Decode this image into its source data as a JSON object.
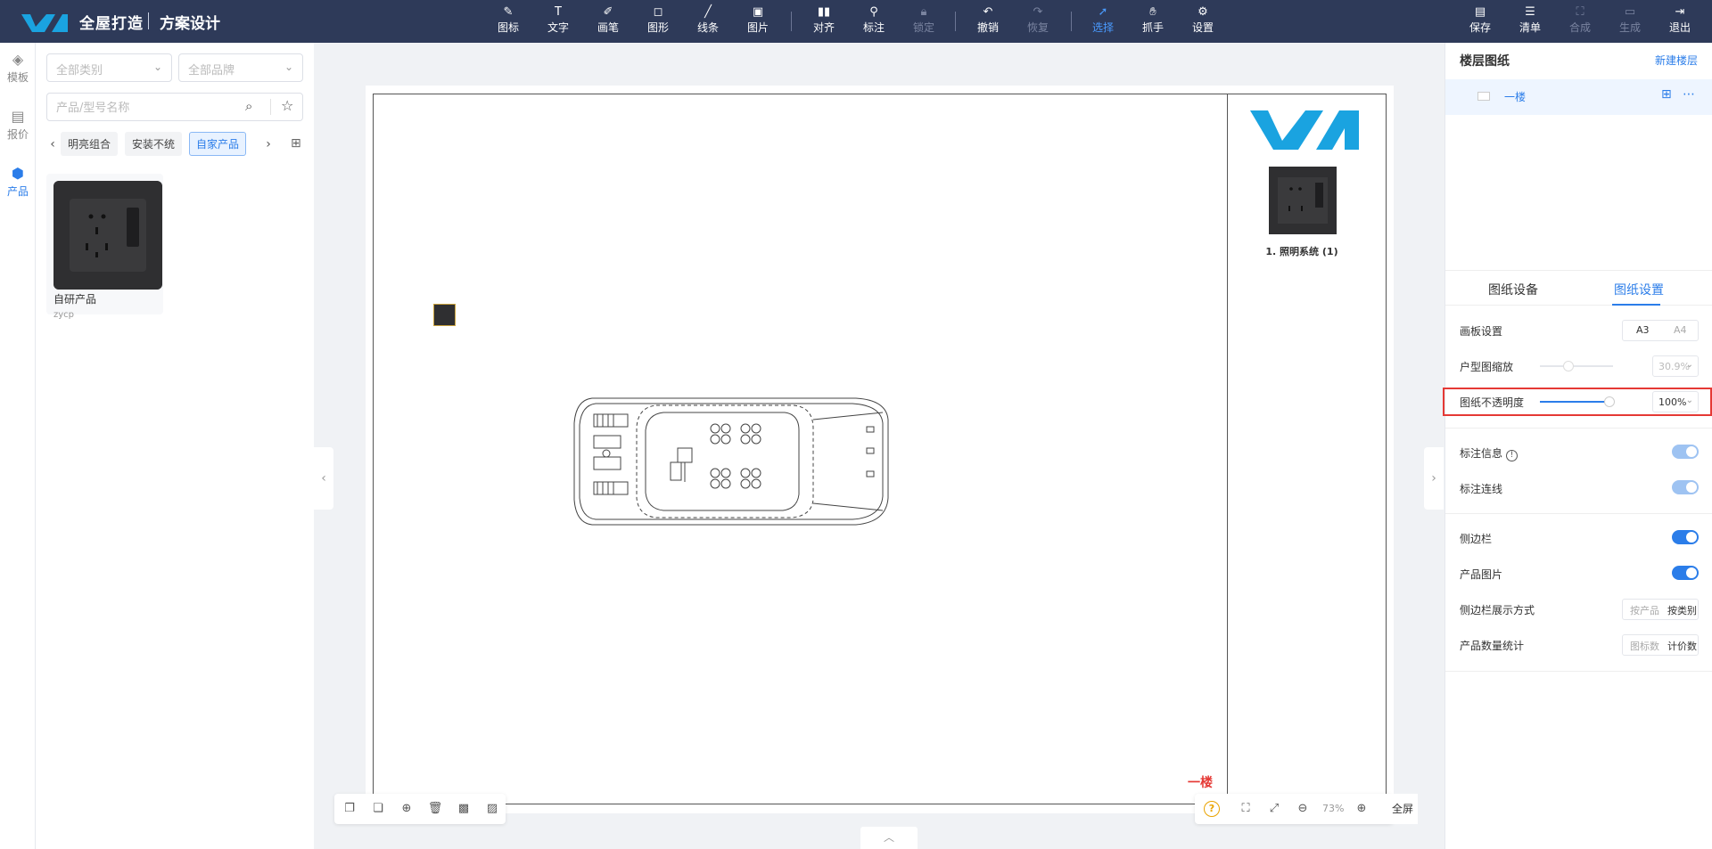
{
  "header": {
    "brand": "全屋打造",
    "subbrand": "方案设计",
    "tools": [
      {
        "label": "图标",
        "icon": "icon-tool-icon"
      },
      {
        "label": "文字",
        "icon": "text-icon"
      },
      {
        "label": "画笔",
        "icon": "brush-icon"
      },
      {
        "label": "图形",
        "icon": "shape-icon"
      },
      {
        "label": "线条",
        "icon": "line-icon"
      },
      {
        "label": "图片",
        "icon": "image-icon"
      },
      {
        "label": "对齐",
        "icon": "align-icon"
      },
      {
        "label": "标注",
        "icon": "pin-icon"
      },
      {
        "label": "锁定",
        "icon": "lock-icon"
      },
      {
        "label": "撤销",
        "icon": "undo-icon"
      },
      {
        "label": "恢复",
        "icon": "redo-icon"
      },
      {
        "label": "选择",
        "icon": "cursor-icon"
      },
      {
        "label": "抓手",
        "icon": "hand-icon"
      },
      {
        "label": "设置",
        "icon": "gear-icon"
      }
    ],
    "right_actions": [
      {
        "label": "保存",
        "icon": "save-icon"
      },
      {
        "label": "清单",
        "icon": "list-icon"
      },
      {
        "label": "合成",
        "icon": "compose-icon"
      },
      {
        "label": "生成",
        "icon": "generate-icon"
      },
      {
        "label": "退出",
        "icon": "exit-icon"
      }
    ]
  },
  "rail": [
    {
      "label": "模板",
      "icon": "layers-icon"
    },
    {
      "label": "报价",
      "icon": "quote-icon"
    },
    {
      "label": "产品",
      "icon": "cube-icon"
    }
  ],
  "left": {
    "category_placeholder": "全部类别",
    "brand_placeholder": "全部品牌",
    "search_placeholder": "产品/型号名称",
    "tags": [
      "明亮组合",
      "安装不统",
      "自家产品"
    ],
    "product": {
      "name": "自研产品",
      "code": "zycp"
    }
  },
  "canvas": {
    "legend_text": "1. 照明系统 (1)",
    "floor_label": "一楼",
    "zoom": "73%",
    "fullscreen": "全屏"
  },
  "right": {
    "title": "楼层图纸",
    "new_floor": "新建楼层",
    "floor_name": "一楼",
    "tabs": [
      "图纸设备",
      "图纸设置"
    ],
    "board_label": "画板设置",
    "board_options": [
      "A3",
      "A4"
    ],
    "plan_scale_label": "户型图缩放",
    "plan_scale_value": "30.9%",
    "opacity_label": "图纸不透明度",
    "opacity_value": "100%",
    "annot_info_label": "标注信息",
    "annot_line_label": "标注连线",
    "sidebar_label": "侧边栏",
    "product_img_label": "产品图片",
    "sidebar_mode_label": "侧边栏展示方式",
    "sidebar_mode_options": [
      "按产品",
      "按类别"
    ],
    "count_label": "产品数量统计",
    "count_options": [
      "图标数",
      "计价数"
    ]
  },
  "colors": {
    "topbar": "#2e3a59",
    "accent": "#2b7de9",
    "highlight": "#e53935",
    "logo": "#1aa3e0"
  }
}
